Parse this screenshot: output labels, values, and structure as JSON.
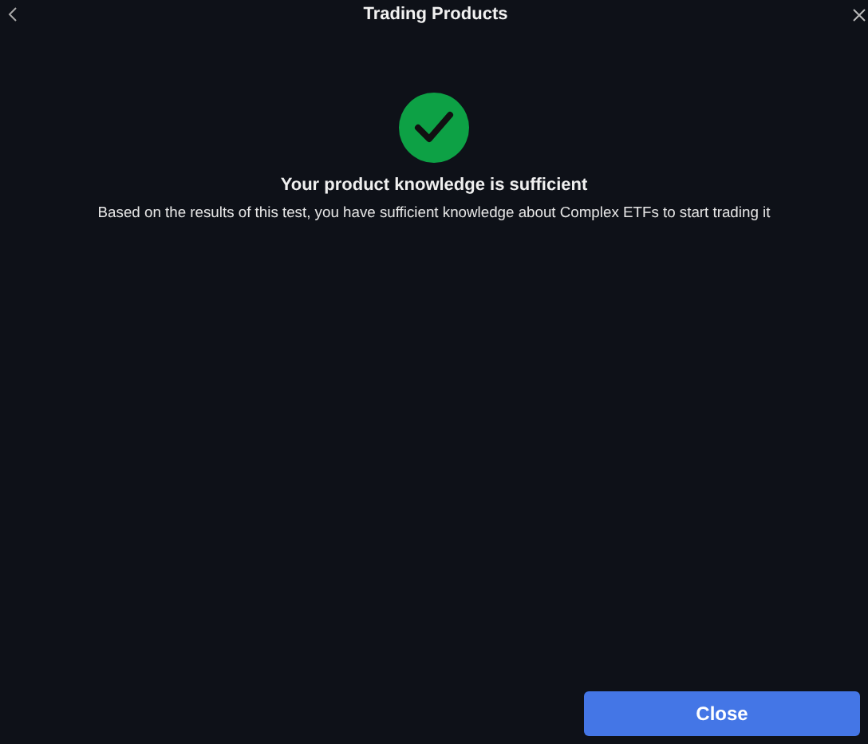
{
  "window": {
    "title": "Trading Products"
  },
  "result": {
    "passed": true,
    "heading": "Your product knowledge is sufficient",
    "message": "Based on the results of this test, you have sufficient knowledge about Complex ETFs to start trading it"
  },
  "buttons": [
    {
      "label": "Close"
    }
  ]
}
